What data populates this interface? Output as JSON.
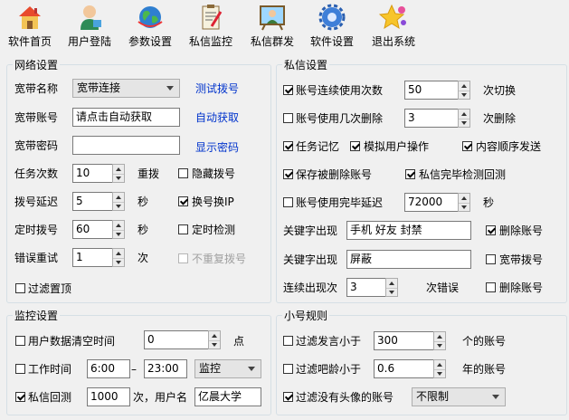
{
  "toolbar": [
    {
      "label": "软件首页",
      "icon": "home-icon"
    },
    {
      "label": "用户登陆",
      "icon": "user-icon"
    },
    {
      "label": "参数设置",
      "icon": "globe-icon"
    },
    {
      "label": "私信监控",
      "icon": "clipboard-icon"
    },
    {
      "label": "私信群发",
      "icon": "board-icon"
    },
    {
      "label": "软件设置",
      "icon": "gear-icon"
    },
    {
      "label": "退出系统",
      "icon": "star-icon"
    }
  ],
  "network": {
    "title": "网络设置",
    "broadband_name_label": "宽带名称",
    "broadband_name_value": "宽带连接",
    "test_dial_link": "测试拨号",
    "account_label": "宽带账号",
    "account_value": "请点击自动获取",
    "auto_get_link": "自动获取",
    "password_label": "宽带密码",
    "password_value": "",
    "show_password_link": "显示密码",
    "task_count_label": "任务次数",
    "task_count_value": "10",
    "redial_label": "重拨",
    "hide_dial_label": "隐藏拨号",
    "dial_delay_label": "拨号延迟",
    "dial_delay_value": "5",
    "sec_label": "秒",
    "change_ip_label": "换号换IP",
    "timed_dial_label": "定时拨号",
    "timed_dial_value": "60",
    "sec_label2": "秒",
    "timed_check_label": "定时检测",
    "error_retry_label": "错误重试",
    "error_retry_value": "1",
    "times_label": "次",
    "no_repeat_dial_label": "不重复拨号",
    "filter_top_label": "过滤置顶"
  },
  "privmsg": {
    "title": "私信设置",
    "acct_switch_label": "账号连续使用次数",
    "acct_switch_value": "50",
    "acct_switch_suffix": "次切换",
    "acct_delete_label": "账号使用几次删除",
    "acct_delete_value": "3",
    "acct_delete_suffix": "次删除",
    "task_memory_label": "任务记忆",
    "simulate_label": "模拟用户操作",
    "content_order_label": "内容顺序发送",
    "save_deleted_label": "保存被删除账号",
    "check_callback_label": "私信完毕检测回测",
    "finish_delay_label": "账号使用完毕延迟",
    "finish_delay_value": "72000",
    "finish_delay_suffix": "秒",
    "keyword1_label": "关键字出现",
    "keyword1_value": "手机 好友 封禁",
    "delete_acct_label": "删除账号",
    "keyword2_label": "关键字出现",
    "keyword2_value": "屏蔽",
    "broadband_dial_label": "宽带拨号",
    "consecutive_label": "连续出现次",
    "consecutive_value": "3",
    "error_suffix": "次错误",
    "delete_acct_label2": "删除账号"
  },
  "monitor": {
    "title": "监控设置",
    "clear_time_label": "用户数据清空时间",
    "clear_time_value": "0",
    "hour_label": "点",
    "work_time_label": "工作时间",
    "work_start": "6:00",
    "dash": "–",
    "work_end": "23:00",
    "mode_value": "监控",
    "callback_label": "私信回测",
    "callback_value": "1000",
    "callback_mid": "次，用户名",
    "username_value": "亿晨大学"
  },
  "filter": {
    "title": "小号规则",
    "speech_label": "过滤发言小于",
    "speech_value": "300",
    "speech_suffix": "个的账号",
    "age_label": "过滤吧龄小于",
    "age_value": "0.6",
    "age_suffix": "年的账号",
    "avatar_label": "过滤没有头像的账号",
    "avatar_value": "不限制"
  },
  "colors": {
    "link": "#0033cc",
    "border": "#d5dfe5",
    "background": "#f0f0f0"
  }
}
